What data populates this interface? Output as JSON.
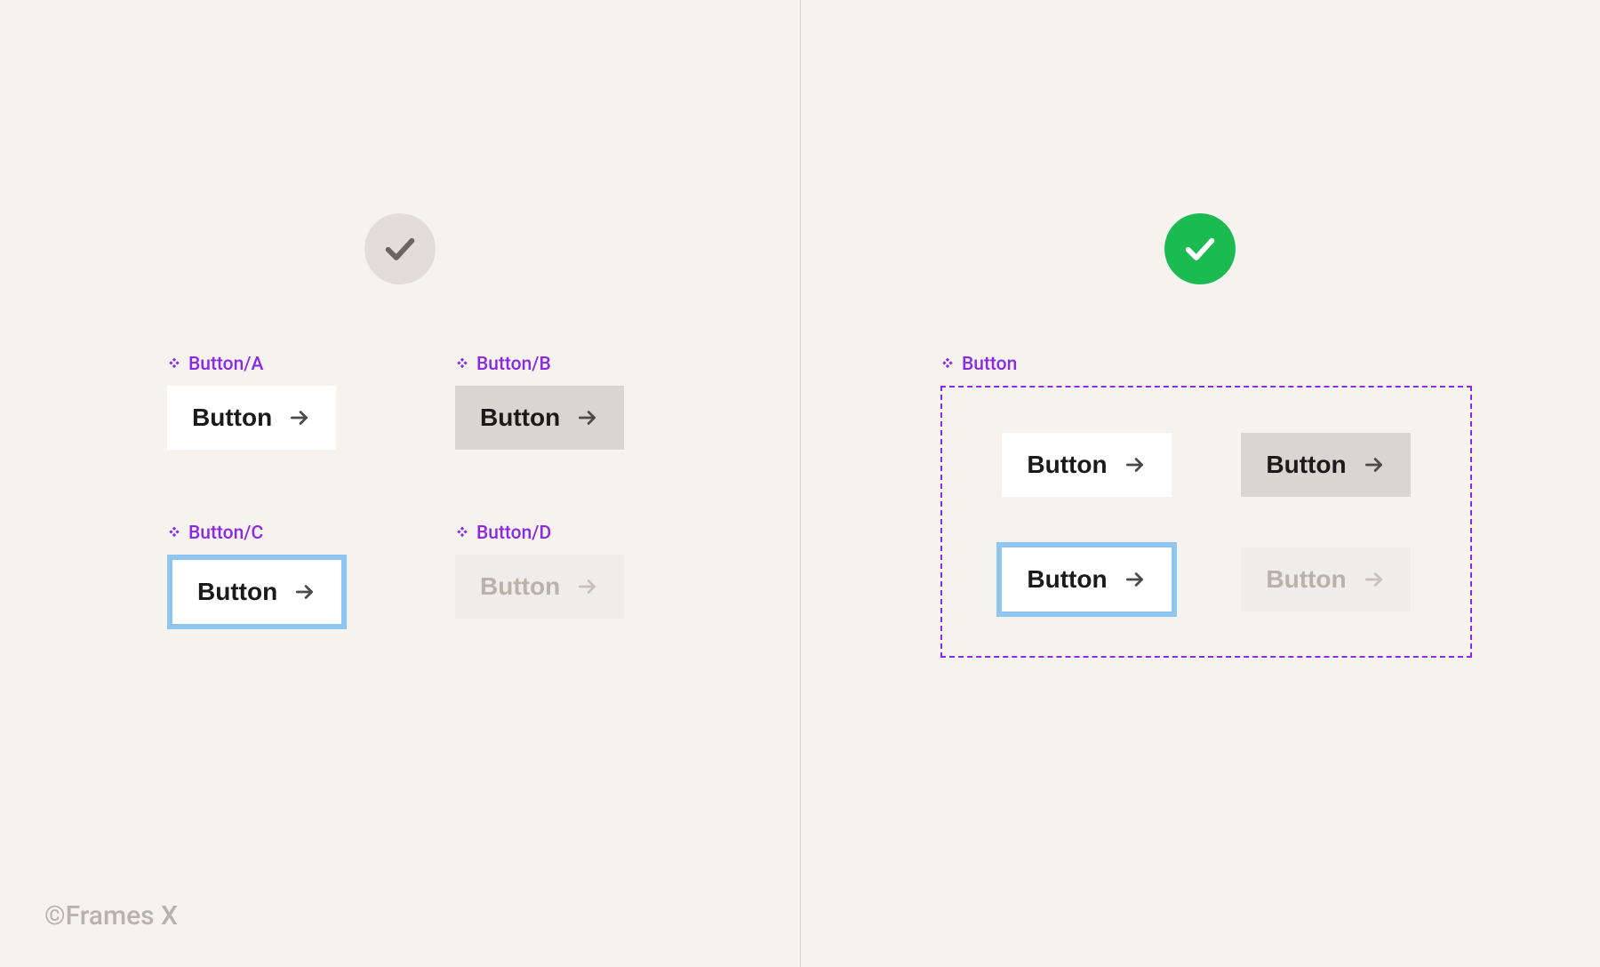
{
  "colors": {
    "background": "#f6f2ee",
    "accent_purple": "#8a2be2",
    "focus_ring": "#8ec6f0",
    "badge_gray": "#e3ddd8",
    "badge_green": "#1cbb52"
  },
  "left": {
    "status": "neutral",
    "components": {
      "a": {
        "label": "Button/A",
        "button_text": "Button",
        "state": "default"
      },
      "b": {
        "label": "Button/B",
        "button_text": "Button",
        "state": "hover"
      },
      "c": {
        "label": "Button/C",
        "button_text": "Button",
        "state": "focus"
      },
      "d": {
        "label": "Button/D",
        "button_text": "Button",
        "state": "disabled"
      }
    }
  },
  "right": {
    "status": "good",
    "component_label": "Button",
    "variants": [
      {
        "button_text": "Button",
        "state": "default"
      },
      {
        "button_text": "Button",
        "state": "hover"
      },
      {
        "button_text": "Button",
        "state": "focus"
      },
      {
        "button_text": "Button",
        "state": "disabled"
      }
    ]
  },
  "credit": "©Frames X"
}
